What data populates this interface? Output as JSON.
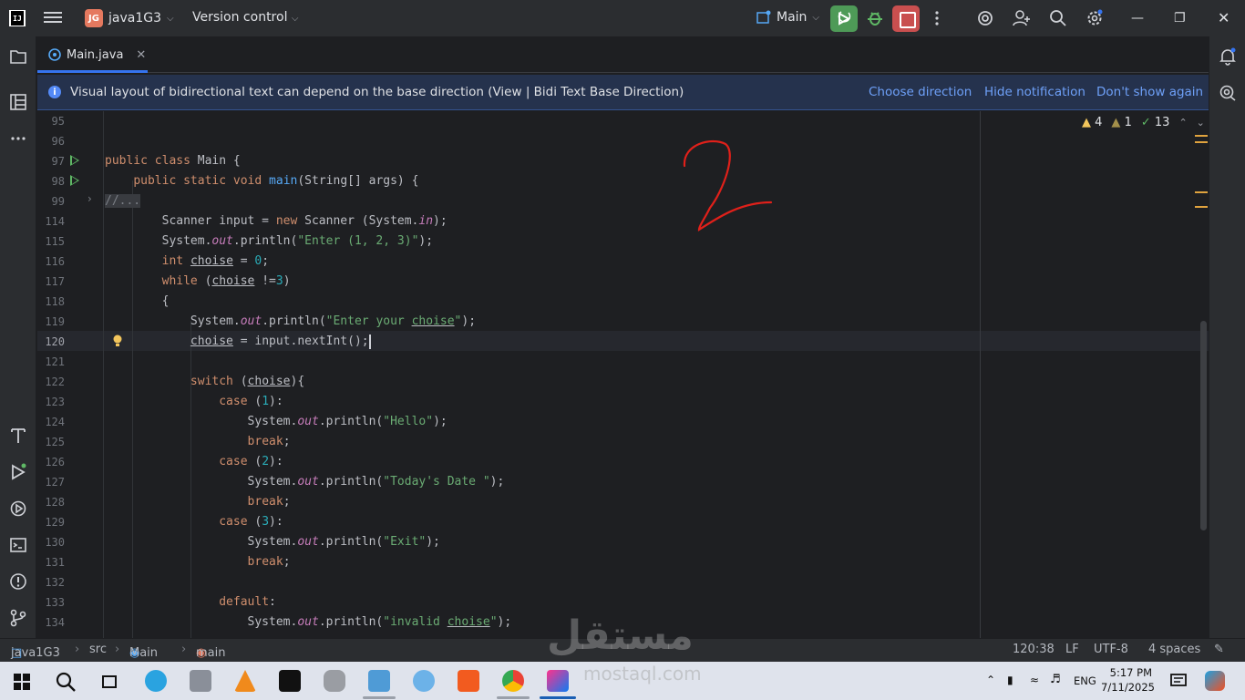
{
  "titlebar": {
    "project_badge": "JG",
    "project_name": "java1G3",
    "vcs_label": "Version control",
    "run_config": "Main"
  },
  "tabs": [
    {
      "label": "Main.java",
      "active": true
    }
  ],
  "notification": {
    "message": "Visual layout of bidirectional text can depend on the base direction (View | Bidi Text Base Direction)",
    "actions": [
      "Choose direction",
      "Hide notification",
      "Don't show again"
    ]
  },
  "inspections": {
    "warnings": "4",
    "weak_warnings": "1",
    "typos": "13"
  },
  "editor": {
    "line_numbers": [
      "95",
      "96",
      "97",
      "98",
      "99",
      "114",
      "115",
      "116",
      "117",
      "118",
      "119",
      "120",
      "121",
      "122",
      "123",
      "124",
      "125",
      "126",
      "127",
      "128",
      "129",
      "130",
      "131",
      "132",
      "133",
      "134"
    ],
    "current_line": "120",
    "lines": [
      "",
      "",
      "public class Main {",
      "    public static void main(String[] args) {",
      "//...",
      "        Scanner input = new Scanner (System.in);",
      "        System.out.println(\"Enter (1, 2, 3)\");",
      "        int choise = 0;",
      "        while (choise !=3)",
      "        {",
      "            System.out.println(\"Enter your choise\");",
      "            choise = input.nextInt();",
      "",
      "            switch (choise){",
      "                case (1):",
      "                    System.out.println(\"Hello\");",
      "                    break;",
      "                case (2):",
      "                    System.out.println(\"Today's Date \");",
      "                    break;",
      "                case (3):",
      "                    System.out.println(\"Exit\");",
      "                    break;",
      "",
      "                default:",
      "                    System.out.println(\"invalid choise\");"
    ],
    "annotation": "2"
  },
  "status": {
    "breadcrumbs": [
      "java1G3",
      "src",
      "Main",
      "main"
    ],
    "position": "120:38",
    "line_separator": "LF",
    "encoding": "UTF-8",
    "indent": "4 spaces"
  },
  "taskbar": {
    "language": "ENG",
    "time": "5:17 PM",
    "date": "7/11/2025"
  },
  "watermark": {
    "text": "مستقل",
    "subtext": "mostaql.com"
  },
  "colors": {
    "accent": "#3574f0",
    "run_green": "#4e9a57",
    "stop_red": "#c94f4f",
    "annotation_red": "#e0201a"
  }
}
